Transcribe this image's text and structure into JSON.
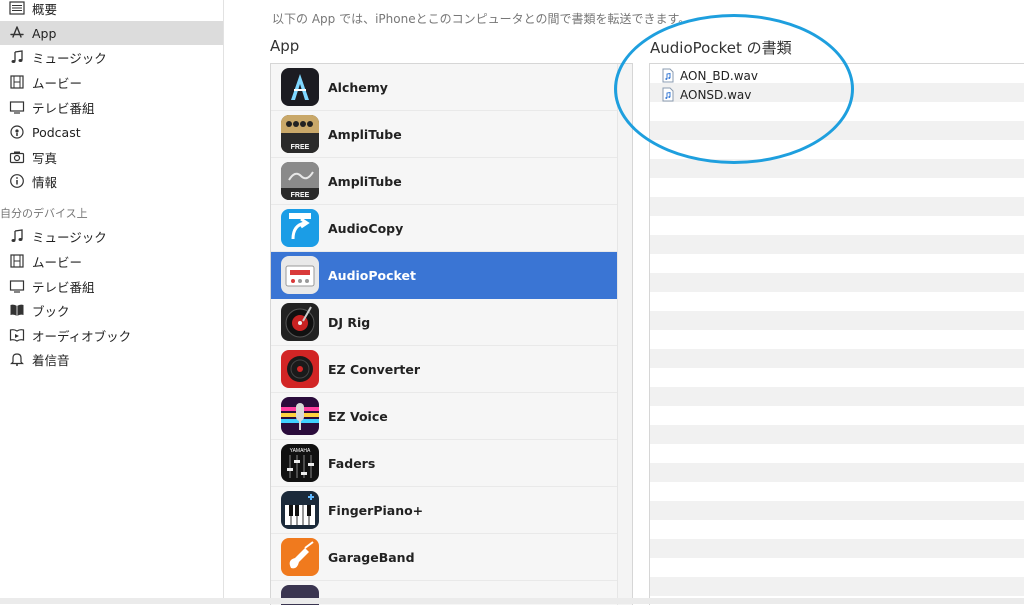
{
  "sidebar": {
    "items": [
      {
        "label": "概要",
        "icon": "list-icon"
      },
      {
        "label": "App",
        "icon": "app-store-icon",
        "selected": true
      },
      {
        "label": "ミュージック",
        "icon": "music-note-icon"
      },
      {
        "label": "ムービー",
        "icon": "film-icon"
      },
      {
        "label": "テレビ番組",
        "icon": "tv-icon"
      },
      {
        "label": "Podcast",
        "icon": "podcast-icon"
      },
      {
        "label": "写真",
        "icon": "camera-icon"
      },
      {
        "label": "情報",
        "icon": "info-icon"
      }
    ],
    "section_title": "自分のデバイス上",
    "device_items": [
      {
        "label": "ミュージック",
        "icon": "music-note-icon"
      },
      {
        "label": "ムービー",
        "icon": "film-icon"
      },
      {
        "label": "テレビ番組",
        "icon": "tv-icon"
      },
      {
        "label": "ブック",
        "icon": "book-icon"
      },
      {
        "label": "オーディオブック",
        "icon": "audiobook-icon"
      },
      {
        "label": "着信音",
        "icon": "bell-icon"
      }
    ]
  },
  "main": {
    "description": "以下の App では、iPhoneとこのコンピュータとの間で書類を転送できます。",
    "apps_header": "App",
    "documents_header": "AudioPocket の書類",
    "apps": [
      {
        "name": "Alchemy",
        "icon": "alchemy-app-icon"
      },
      {
        "name": "AmpliTube",
        "icon": "amplitube-app-icon"
      },
      {
        "name": "AmpliTube",
        "icon": "amplitube-fender-app-icon"
      },
      {
        "name": "AudioCopy",
        "icon": "audiocopy-app-icon"
      },
      {
        "name": "AudioPocket",
        "icon": "audiopocket-app-icon",
        "selected": true
      },
      {
        "name": "DJ Rig",
        "icon": "djrig-app-icon"
      },
      {
        "name": "EZ Converter",
        "icon": "ezconverter-app-icon"
      },
      {
        "name": "EZ Voice",
        "icon": "ezvoice-app-icon"
      },
      {
        "name": "Faders",
        "icon": "faders-app-icon"
      },
      {
        "name": "FingerPiano+",
        "icon": "fingerpiano-app-icon"
      },
      {
        "name": "GarageBand",
        "icon": "garageband-app-icon"
      }
    ],
    "icon_texts": {
      "amplitube": "FREE",
      "amplitube_fender": "FREE",
      "faders": "YAMAHA"
    },
    "documents": [
      {
        "name": "AON_BD.wav",
        "icon": "audio-file-icon"
      },
      {
        "name": "AONSD.wav",
        "icon": "audio-file-icon"
      }
    ]
  },
  "colors": {
    "selection": "#3a75d4",
    "highlight_circle": "#1e9fde"
  }
}
